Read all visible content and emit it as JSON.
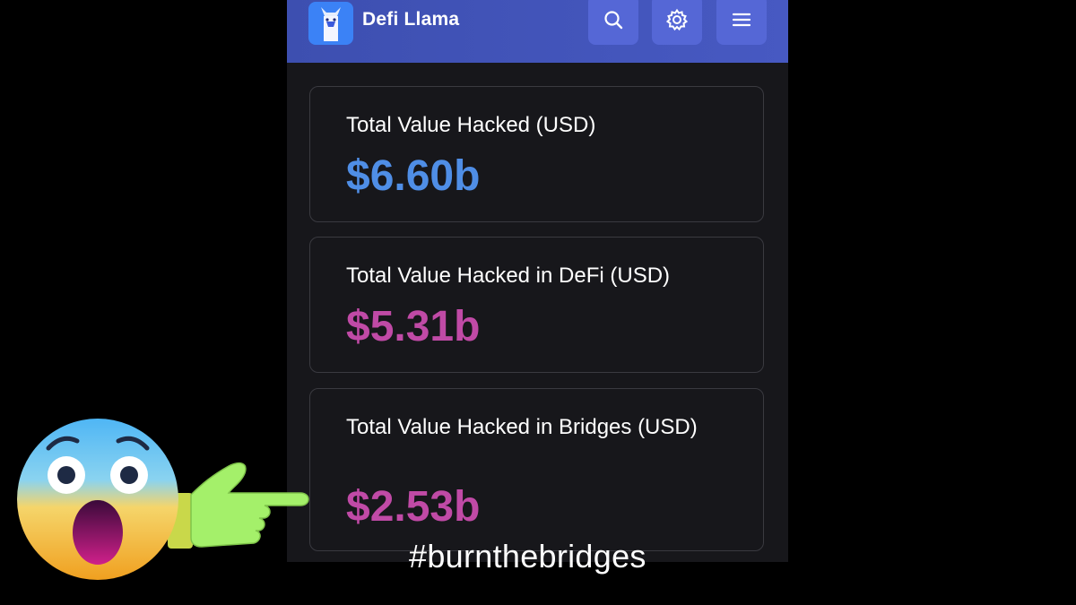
{
  "header": {
    "brand": "Defi Llama",
    "color": "#4759c2",
    "icons": [
      "llama-logo",
      "search-icon",
      "gear-icon",
      "menu-icon"
    ]
  },
  "cards": [
    {
      "label": "Total Value Hacked (USD)",
      "value": "$6.60b",
      "color": "#4f8ee6"
    },
    {
      "label": "Total Value Hacked in DeFi (USD)",
      "value": "$5.31b",
      "color": "#c04aa6"
    },
    {
      "label": "Total Value Hacked in Bridges (USD)",
      "value": "$2.53b",
      "color": "#c04aa6"
    }
  ],
  "overlay": {
    "hashtag": "#burnthebridges",
    "emoji": "screaming-face-emoji",
    "hand": "pointing-right-hand"
  }
}
